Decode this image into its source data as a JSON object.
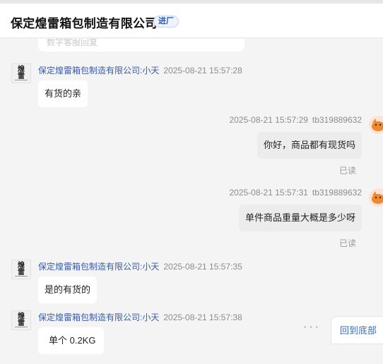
{
  "header": {
    "shop_name": "保定煌雷箱包制造有限公司",
    "badge": "进厂"
  },
  "chat": {
    "previous_snippet": "数字客服回复",
    "messages": [
      {
        "side": "left",
        "sender": "保定煌雷箱包制造有限公司:小天",
        "time": "2025-08-21 15:57:28",
        "text": "有货的亲"
      },
      {
        "side": "right",
        "sender": "tb319889632",
        "time": "2025-08-21 15:57:29",
        "text": "你好，商品都有现货吗",
        "status": "已读"
      },
      {
        "side": "right",
        "sender": "tb319889632",
        "time": "2025-08-21 15:57:31",
        "text": "单件商品重量大概是多少呀",
        "status": "已读"
      },
      {
        "side": "left",
        "sender": "保定煌雷箱包制造有限公司:小天",
        "time": "2025-08-21 15:57:35",
        "text": "是的有货的"
      },
      {
        "side": "left",
        "sender": "保定煌雷箱包制造有限公司:小天",
        "time": "2025-08-21 15:57:38",
        "text": "单个 0.2KG"
      }
    ],
    "avatar_logo_text": "煌雷",
    "back_to_bottom": "回到底部",
    "more_dots": "• • •"
  },
  "colors": {
    "sender_name": "#3a5ba8",
    "badge_text": "#2e5fb4",
    "right_bubble": "#ececec",
    "left_bubble": "#ffffff"
  }
}
